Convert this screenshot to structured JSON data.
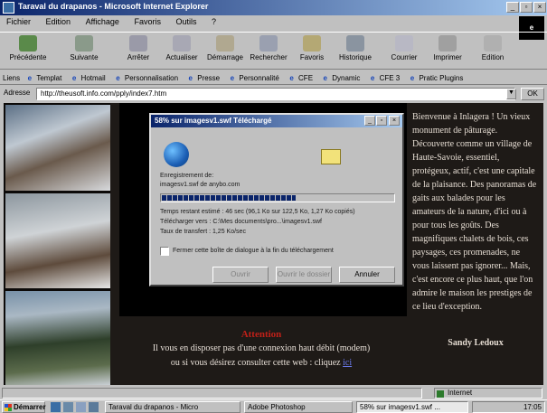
{
  "window": {
    "title": "Taraval du drapanos - Microsoft Internet Explorer"
  },
  "menu": [
    "Fichier",
    "Edition",
    "Affichage",
    "Favoris",
    "Outils",
    "?"
  ],
  "toolbar": [
    "Précédente",
    "Suivante",
    "Arrêter",
    "Actualiser",
    "Démarrage",
    "Rechercher",
    "Favoris",
    "Historique",
    "Courrier",
    "Imprimer",
    "Edition"
  ],
  "links": {
    "label": "Liens",
    "items": [
      "Templat",
      "Hotmail",
      "Personnalisation",
      "Presse",
      "Personnalité",
      "CFE",
      "Dynamic",
      "CFE 3",
      "Pratic Plugins"
    ]
  },
  "address": {
    "label": "Adresse",
    "url": "http://theusoft.info.com/pply/index7.htm",
    "go": "OK"
  },
  "page": {
    "right_text": "Bienvenue à Inlagera ! Un vieux monument de pâturage. Découverte comme un village de Haute-Savoie, essentiel, protégeux, actif, c'est une capitale de la plaisance. Des panoramas de gaits aux balades pour les amateurs de la nature, d'ici ou à pour tous les goûts. Des magnifiques chalets de bois, ces paysages, ces promenades, ne vous laissent pas ignorer... Mais, c'est encore ce plus haut, que l'on admire le maison les prestiges de ce lieu d'exception.",
    "signature": "Sandy Ledoux",
    "red_title": "Attention",
    "line1": "Il vous en disposer pas d'une connexion haut débit (modem)",
    "line2": "ou si vous désirez consulter cette web : cliquez",
    "link": "ici"
  },
  "dialog": {
    "title": "58% sur imagesv1.swf Téléchargé",
    "saving_label": "Enregistrement de:",
    "file_from": "imagesv1.swf de anybo.com",
    "time_remaining": "Temps restant estimé :   46 sec (96,1 Ko sur 122,5 Ko, 1,27 Ko copiés)",
    "download_to": "Télécharger vers :   C:\\Mes documents\\pro...\\imagesv1.swf",
    "transfer_rate": "Taux de transfert :   1,25 Ko/sec",
    "checkbox_label": "Fermer cette boîte de dialogue à la fin du téléchargement",
    "progress": 0.58,
    "buttons": [
      "Ouvrir",
      "Ouvrir le dossier",
      "Annuler"
    ]
  },
  "status": {
    "zone": "Internet"
  },
  "taskbar": {
    "start": "Démarrer",
    "tasks": [
      "Taraval du drapanos - Micro",
      "Adobe Photoshop",
      "58% sur imagesv1.swf ..."
    ],
    "time": "17:05"
  }
}
